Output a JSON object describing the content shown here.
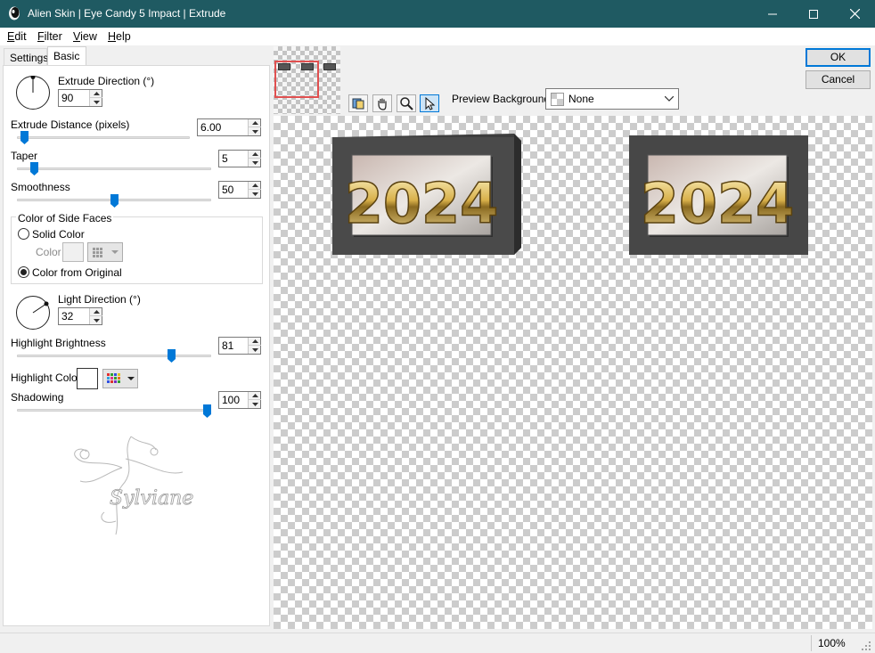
{
  "window": {
    "title": "Alien Skin | Eye Candy 5 Impact | Extrude"
  },
  "menu": {
    "items": [
      {
        "underline": "E",
        "rest": "dit"
      },
      {
        "underline": "F",
        "rest": "ilter"
      },
      {
        "underline": "V",
        "rest": "iew"
      },
      {
        "underline": "H",
        "rest": "elp"
      }
    ]
  },
  "tabs": {
    "settings": "Settings",
    "basic": "Basic"
  },
  "controls": {
    "extrude_direction": {
      "label": "Extrude Direction (°)",
      "value": "90"
    },
    "extrude_distance": {
      "label": "Extrude Distance (pixels)",
      "value": "6.00",
      "slider_fraction": 0.02
    },
    "taper": {
      "label": "Taper",
      "value": "5",
      "slider_fraction": 0.07
    },
    "smoothness": {
      "label": "Smoothness",
      "value": "50",
      "slider_fraction": 0.5
    },
    "color_of_side_faces": {
      "title": "Color of Side Faces",
      "solid_color": "Solid Color",
      "color_label": "Color",
      "color_from_original": "Color from Original",
      "selected": "color_from_original"
    },
    "light_direction": {
      "label": "Light Direction (°)",
      "value": "32"
    },
    "highlight_brightness": {
      "label": "Highlight Brightness",
      "value": "81",
      "slider_fraction": 0.81
    },
    "highlight_color": {
      "label": "Highlight Color",
      "color": "#ffffff"
    },
    "shadowing": {
      "label": "Shadowing",
      "value": "100",
      "slider_fraction": 1.0
    }
  },
  "watermark": {
    "text": "Sylviane"
  },
  "toolbar": {
    "preview_background_label": "Preview Background:",
    "preview_background_value": "None"
  },
  "buttons": {
    "ok": "OK",
    "cancel": "Cancel"
  },
  "preview": {
    "image_text": "2024"
  },
  "status": {
    "zoom": "100%"
  },
  "colors": {
    "titlebar": "#1f5a62",
    "accent": "#0078d7",
    "nav_frame": "#e05050",
    "extrude_face": "#4a4a4a"
  }
}
